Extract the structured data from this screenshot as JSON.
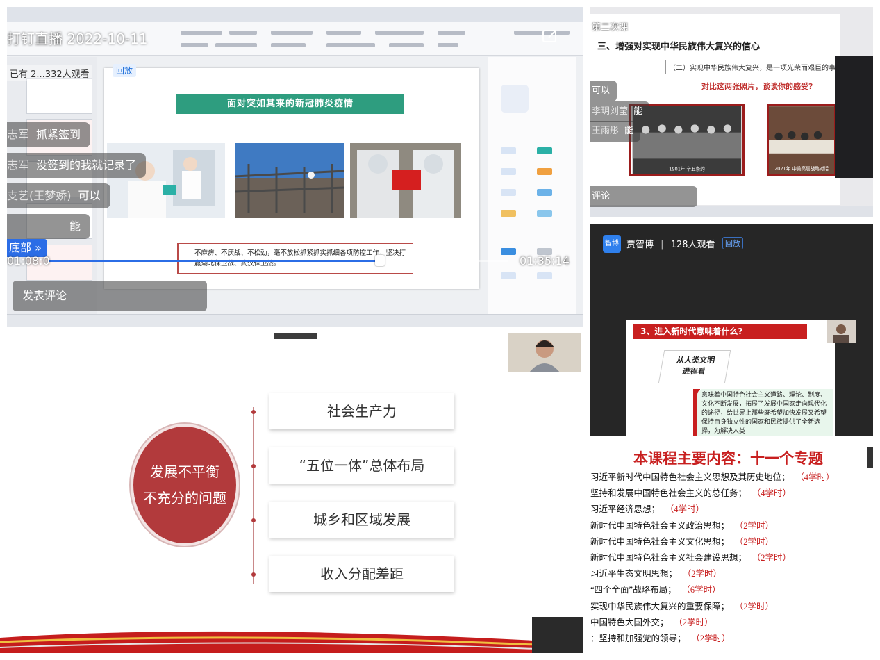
{
  "top_left_stream": {
    "title_date": "打钉直播  2022-10-11",
    "viewers_text": "已有 2...332人观看",
    "replay_badge": "回放",
    "slide_banner": "面对突如其来的新冠肺炎疫情",
    "slide_quote": "不麻痹、不厌战、不松劲，毫不放松抓紧抓实抓细各项防控工作，坚决打赢湖北保卫战、武汉保卫战。",
    "comments": [
      {
        "user": "志军",
        "text": "抓紧签到"
      },
      {
        "user": "志军",
        "text": "没签到的我就记录了"
      },
      {
        "user": "支艺(王梦娇)",
        "text": "可以"
      },
      {
        "user": "",
        "text": "能"
      }
    ],
    "jump_bottom_label": "底部 »",
    "time_current": "01:08:0",
    "time_total": "01:35:14",
    "progress_fraction": 0.72,
    "comment_placeholder": "发表评论"
  },
  "top_right_stream": {
    "session_label": "第二次课",
    "slide_heading": "三、增强对实现中华民族伟大复兴的信心",
    "slide_subheading": "（二）实现中华民族伟大复兴，是一项光荣而艰巨的事业",
    "slide_question": "对比这两张照片，谈谈你的感受?",
    "photo_left_caption": "1901年 辛丑条约",
    "photo_right_caption": "2021年 中美高层战略对话",
    "comments": [
      {
        "user": "",
        "text": "可以"
      },
      {
        "user": "李玥刘莹",
        "text": "能"
      },
      {
        "user": "王雨彤",
        "text": "能"
      }
    ],
    "comment_placeholder": "评论"
  },
  "mid_right_stream": {
    "host_avatar": "智博",
    "host_name": "贾智博",
    "separator": "|",
    "viewers_text": "128人观看",
    "replay_badge": "回放",
    "slide_title": "3、进入新时代意味着什么?",
    "badge_line1": "从人类文明",
    "badge_line2": "进程看",
    "body_text": "意味着中国特色社会主义道路、理论、制度、文化不断发展，拓展了发展中国家走向现代化的途径，给世界上那些既希望加快发展又希望保持自身独立性的国家和民族提供了全新选择，为解决人类"
  },
  "bottom_left_slide": {
    "center_line1": "发展不平衡",
    "center_line2": "不充分的问题",
    "items": [
      "社会生产力",
      "“五位一体”总体布局",
      "城乡和区域发展",
      "收入分配差距"
    ]
  },
  "course_list": {
    "title": "本课程主要内容：十一个专题",
    "items": [
      {
        "name": "习近平新时代中国特色社会主义思想及其历史地位；",
        "hours": "（4学时）"
      },
      {
        "name": "坚持和发展中国特色社会主义的总任务；",
        "hours": "（4学时）"
      },
      {
        "name": "习近平经济思想；",
        "hours": "（4学时）"
      },
      {
        "name": "新时代中国特色社会主义政治思想；",
        "hours": "（2学时）"
      },
      {
        "name": "新时代中国特色社会主义文化思想；",
        "hours": "（2学时）"
      },
      {
        "name": "新时代中国特色社会主义社会建设思想；",
        "hours": "（2学时）"
      },
      {
        "name": "习近平生态文明思想；",
        "hours": "（2学时）"
      },
      {
        "name": "“四个全面”战略布局；",
        "hours": "（6学时）"
      },
      {
        "name": "实现中华民族伟大复兴的重要保障；",
        "hours": "（2学时）"
      },
      {
        "name": "中国特色大国外交；",
        "hours": "（2学时）"
      },
      {
        "name": "：坚持和加强党的领导；",
        "hours": "（2学时）"
      }
    ]
  },
  "colors": {
    "accent_blue": "#2b6de6",
    "accent_red": "#c81f1f",
    "banner_green": "#2e9d7f"
  }
}
